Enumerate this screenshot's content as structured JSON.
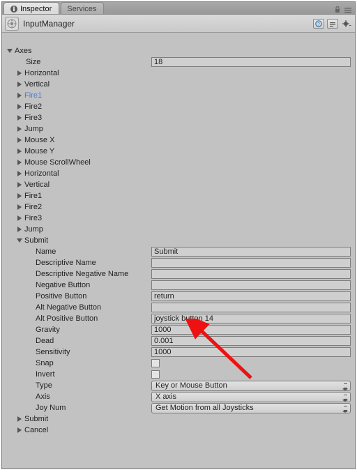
{
  "tabs": {
    "inspector": "Inspector",
    "services": "Services"
  },
  "header": {
    "title": "InputManager"
  },
  "axes": {
    "label": "Axes",
    "size_label": "Size",
    "size_value": "18",
    "items": [
      {
        "label": "Horizontal",
        "expanded": false,
        "selected": false
      },
      {
        "label": "Vertical",
        "expanded": false,
        "selected": false
      },
      {
        "label": "Fire1",
        "expanded": false,
        "selected": true
      },
      {
        "label": "Fire2",
        "expanded": false,
        "selected": false
      },
      {
        "label": "Fire3",
        "expanded": false,
        "selected": false
      },
      {
        "label": "Jump",
        "expanded": false,
        "selected": false
      },
      {
        "label": "Mouse X",
        "expanded": false,
        "selected": false
      },
      {
        "label": "Mouse Y",
        "expanded": false,
        "selected": false
      },
      {
        "label": "Mouse ScrollWheel",
        "expanded": false,
        "selected": false
      },
      {
        "label": "Horizontal",
        "expanded": false,
        "selected": false
      },
      {
        "label": "Vertical",
        "expanded": false,
        "selected": false
      },
      {
        "label": "Fire1",
        "expanded": false,
        "selected": false
      },
      {
        "label": "Fire2",
        "expanded": false,
        "selected": false
      },
      {
        "label": "Fire3",
        "expanded": false,
        "selected": false
      },
      {
        "label": "Jump",
        "expanded": false,
        "selected": false
      }
    ],
    "submit": {
      "label": "Submit",
      "expanded": true,
      "fields": {
        "name": {
          "label": "Name",
          "value": "Submit"
        },
        "descriptive_name": {
          "label": "Descriptive Name",
          "value": ""
        },
        "descriptive_negative_name": {
          "label": "Descriptive Negative Name",
          "value": ""
        },
        "negative_button": {
          "label": "Negative Button",
          "value": ""
        },
        "positive_button": {
          "label": "Positive Button",
          "value": "return"
        },
        "alt_negative_button": {
          "label": "Alt Negative Button",
          "value": ""
        },
        "alt_positive_button": {
          "label": "Alt Positive Button",
          "value": "joystick button 14"
        },
        "gravity": {
          "label": "Gravity",
          "value": "1000"
        },
        "dead": {
          "label": "Dead",
          "value": "0.001"
        },
        "sensitivity": {
          "label": "Sensitivity",
          "value": "1000"
        },
        "snap": {
          "label": "Snap",
          "checked": false
        },
        "invert": {
          "label": "Invert",
          "checked": false
        },
        "type": {
          "label": "Type",
          "value": "Key or Mouse Button"
        },
        "axis": {
          "label": "Axis",
          "value": "X axis"
        },
        "joy_num": {
          "label": "Joy Num",
          "value": "Get Motion from all Joysticks"
        }
      }
    },
    "trailing": [
      {
        "label": "Submit",
        "expanded": false
      },
      {
        "label": "Cancel",
        "expanded": false
      }
    ]
  }
}
